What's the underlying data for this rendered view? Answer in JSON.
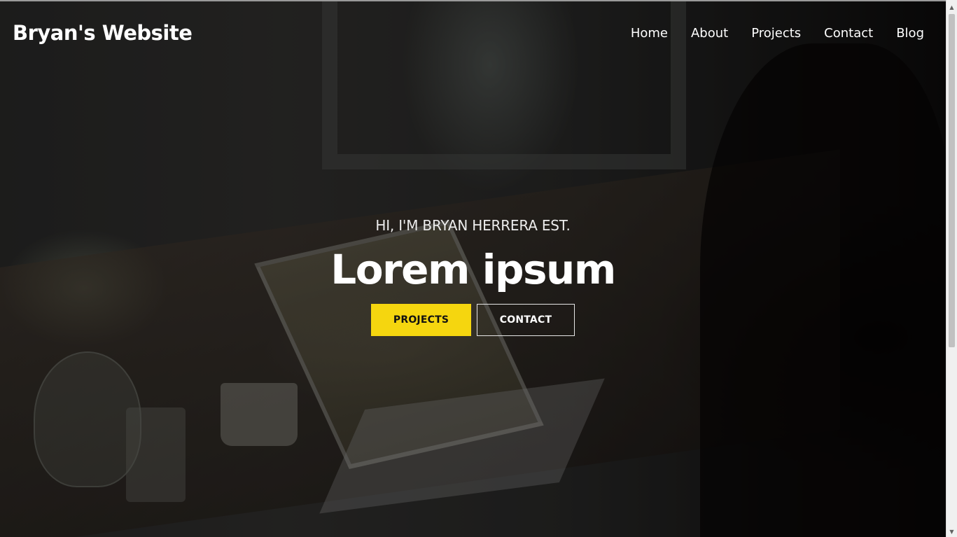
{
  "header": {
    "brand": "Bryan's Website",
    "nav": [
      "Home",
      "About",
      "Projects",
      "Contact",
      "Blog"
    ]
  },
  "hero": {
    "intro": "HI, I'M BRYAN HERRERA EST.",
    "headline": "Lorem ipsum",
    "primary_button": "PROJECTS",
    "secondary_button": "CONTACT"
  },
  "colors": {
    "accent": "#f5d60f",
    "text": "#ffffff"
  },
  "scrollbar": {
    "up_icon": "arrow-up-icon",
    "down_icon": "arrow-down-icon"
  }
}
